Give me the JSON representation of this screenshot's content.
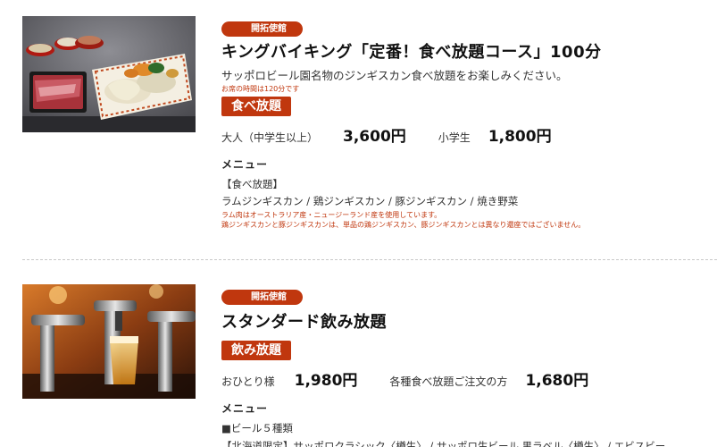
{
  "items": [
    {
      "store_badge": "開拓使館",
      "title": "キングバイキング「定番！食べ放題コース」100分",
      "description": "サッポロビール園名物のジンギスカン食べ放題をお楽しみください。",
      "time_note": "お席の時間は120分です",
      "type_badge": "食べ放題",
      "prices": [
        {
          "label": "大人（中学生以上）",
          "value": "3,600円"
        },
        {
          "label": "小学生",
          "value": "1,800円"
        }
      ],
      "menu_heading": "メニュー",
      "menu_lines": [
        "【食べ放題】",
        "ラムジンギスカン / 鶏ジンギスカン / 豚ジンギスカン / 焼き野菜"
      ],
      "menu_notes": [
        "ラム肉はオーストラリア産・ニュージーランド産を使用しています。",
        "鶏ジンギスカンと豚ジンギスカンは、単品の鶏ジンギスカン、豚ジンギスカンとは異なり還座ではございません。"
      ]
    },
    {
      "store_badge": "開拓使館",
      "title": "スタンダード飲み放題",
      "type_badge": "飲み放題",
      "prices": [
        {
          "label": "おひとり様",
          "value": "1,980円"
        },
        {
          "label": "各種食べ放題ご注文の方",
          "value": "1,680円"
        }
      ],
      "menu_heading": "メニュー",
      "menu_lines": [
        "■ビール５種類",
        "【北海道限定】サッポロクラシック〈樽生〉 / サッポロ生ビール 黒ラベル〈樽生〉 / エビスビー"
      ]
    }
  ],
  "colors": {
    "accent": "#c0370e"
  }
}
